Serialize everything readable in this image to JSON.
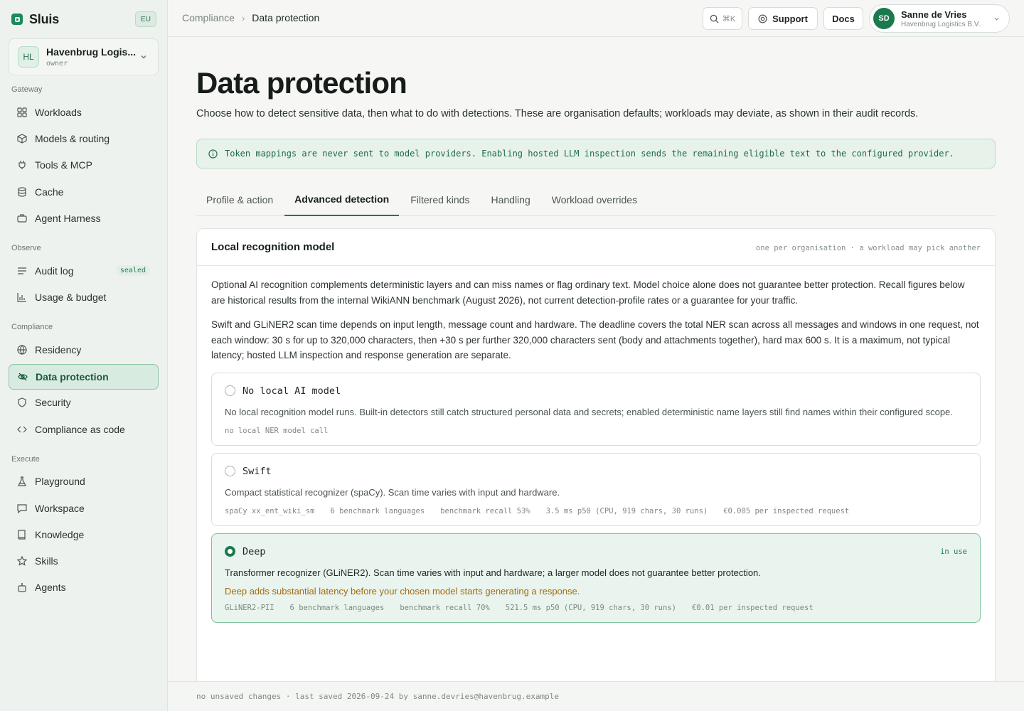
{
  "brand": {
    "name": "Sluis",
    "region": "EU"
  },
  "org": {
    "initials": "HL",
    "name": "Havenbrug Logistics B.V.",
    "name_short": "Havenbrug Logis...",
    "role": "owner"
  },
  "sidebar": {
    "sections": {
      "gateway": "Gateway",
      "observe": "Observe",
      "compliance": "Compliance",
      "execute": "Execute"
    },
    "items": [
      {
        "label": "Workloads",
        "icon": "grid-icon"
      },
      {
        "label": "Models & routing",
        "icon": "cube-icon"
      },
      {
        "label": "Tools & MCP",
        "icon": "plug-icon"
      },
      {
        "label": "Cache",
        "icon": "database-icon"
      },
      {
        "label": "Agent Harness",
        "icon": "briefcase-icon"
      },
      {
        "label": "Audit log",
        "icon": "list-icon",
        "badge": "sealed"
      },
      {
        "label": "Usage & budget",
        "icon": "bar-chart-icon"
      },
      {
        "label": "Residency",
        "icon": "globe-icon"
      },
      {
        "label": "Data protection",
        "icon": "eye-off-icon",
        "active": true
      },
      {
        "label": "Security",
        "icon": "shield-icon"
      },
      {
        "label": "Compliance as code",
        "icon": "code-icon"
      },
      {
        "label": "Playground",
        "icon": "flask-icon"
      },
      {
        "label": "Workspace",
        "icon": "chat-icon"
      },
      {
        "label": "Knowledge",
        "icon": "book-icon"
      },
      {
        "label": "Skills",
        "icon": "star-icon"
      },
      {
        "label": "Agents",
        "icon": "robot-icon"
      }
    ]
  },
  "breadcrumb": {
    "parent": "Compliance",
    "current": "Data protection"
  },
  "topbar": {
    "search_shortcut": "⌘K",
    "support_label": "Support",
    "docs_label": "Docs"
  },
  "user": {
    "initials": "SD",
    "name": "Sanne de Vries",
    "org": "Havenbrug Logistics B.V."
  },
  "page": {
    "title": "Data protection",
    "description": "Choose how to detect sensitive data, then what to do with detections. These are organisation defaults; workloads may deviate, as shown in their audit records.",
    "banner": "Token mappings are never sent to model providers. Enabling hosted LLM inspection sends the remaining eligible text to the configured provider."
  },
  "tabs": [
    {
      "label": "Profile & action"
    },
    {
      "label": "Advanced detection",
      "active": true
    },
    {
      "label": "Filtered kinds"
    },
    {
      "label": "Handling"
    },
    {
      "label": "Workload overrides"
    }
  ],
  "card": {
    "title": "Local recognition model",
    "note": "one per organisation · a workload may pick another",
    "para1": "Optional AI recognition complements deterministic layers and can miss names or flag ordinary text. Model choice alone does not guarantee better protection. Recall figures below are historical results from the internal WikiANN benchmark (August 2026), not current detection-profile rates or a guarantee for your traffic.",
    "para2": "Swift and GLiNER2 scan time depends on input length, message count and hardware. The deadline covers the total NER scan across all messages and windows in one request, not each window: 30 s for up to 320,000 characters, then +30 s per further 320,000 characters sent (body and attachments together), hard max 600 s. It is a maximum, not typical latency; hosted LLM inspection and response generation are separate."
  },
  "options": {
    "none": {
      "name": "No local AI model",
      "desc": "No local recognition model runs. Built-in detectors still catch structured personal data and secrets; enabled deterministic name layers still find names within their configured scope.",
      "meta": [
        "no local NER model call"
      ]
    },
    "swift": {
      "name": "Swift",
      "desc": "Compact statistical recognizer (spaCy). Scan time varies with input and hardware.",
      "meta": [
        "spaCy xx_ent_wiki_sm",
        "6 benchmark languages",
        "benchmark recall 53%",
        "3.5 ms p50 (CPU, 919 chars, 30 runs)",
        "€0.005 per inspected request"
      ]
    },
    "deep": {
      "name": "Deep",
      "in_use": "in use",
      "desc": "Transformer recognizer (GLiNER2). Scan time varies with input and hardware; a larger model does not guarantee better protection.",
      "warning": "Deep adds substantial latency before your chosen model starts generating a response.",
      "meta": [
        "GLiNER2-PII",
        "6 benchmark languages",
        "benchmark recall 70%",
        "521.5 ms p50 (CPU, 919 chars, 30 runs)",
        "€0.01 per inspected request"
      ]
    }
  },
  "footer": {
    "status": "no unsaved changes · last saved 2026-09-24 by sanne.devries@havenbrug.example"
  }
}
